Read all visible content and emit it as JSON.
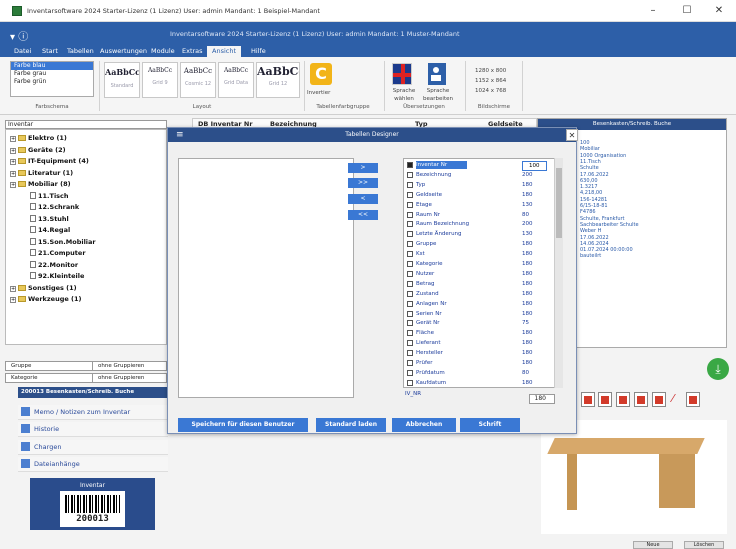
{
  "window": {
    "title": "Inventarsoftware 2024 Starter-Lizenz (1 Lizenz)   User: admin   Mandant: 1 Beispiel-Mandant",
    "doc_title": "Inventarsoftware 2024 Starter-Lizenz (1 Lizenz)   User: admin   Mandant: 1 Muster-Mandant",
    "minimize": "–",
    "maximize": "☐",
    "close": "✕"
  },
  "menu": [
    "Datei",
    "Start",
    "Tabellen",
    "Auswertungen",
    "Module",
    "Extras",
    "Ansicht",
    "Hilfe"
  ],
  "menu_active": "Ansicht",
  "ribbon": {
    "fonts": [
      "Farbe blau",
      "Farbe grau",
      "Farbe grün"
    ],
    "styles": [
      {
        "preview": "AaBbCc",
        "label": "Standard"
      },
      {
        "preview": "AaBbCc",
        "label": "Grid 9"
      },
      {
        "preview": "AaBbCc",
        "label": "Cosmic 12"
      },
      {
        "preview": "AaBbCc",
        "label": "Grid Data"
      },
      {
        "preview": "AaBbCc",
        "label": "Grid 12"
      }
    ],
    "invert_label": "Invertier",
    "lang_label": "Sprache wählen",
    "settings_label": "Sprache bearbeiten",
    "dimensions": [
      "1280 x 800",
      "1152 x 864",
      "1024 x 768"
    ],
    "group_labels": [
      "Farbschema",
      "Layout",
      "Tabellenfarbgruppe",
      "Übersetzungen",
      "Bildschirme"
    ]
  },
  "left": {
    "search": "Inventar",
    "tree": [
      {
        "label": "Elektro (1)",
        "level": 0,
        "type": "folder"
      },
      {
        "label": "Geräte (2)",
        "level": 0,
        "type": "folder"
      },
      {
        "label": "IT-Equipment (4)",
        "level": 0,
        "type": "folder"
      },
      {
        "label": "Literatur (1)",
        "level": 0,
        "type": "folder"
      },
      {
        "label": "Mobiliar (8)",
        "level": 0,
        "type": "folder"
      },
      {
        "label": "11.Tisch",
        "level": 1,
        "type": "doc"
      },
      {
        "label": "12.Schrank",
        "level": 1,
        "type": "doc"
      },
      {
        "label": "13.Stuhl",
        "level": 1,
        "type": "doc"
      },
      {
        "label": "14.Regal",
        "level": 1,
        "type": "doc"
      },
      {
        "label": "15.Son.Mobiliar",
        "level": 1,
        "type": "doc"
      },
      {
        "label": "21.Computer",
        "level": 1,
        "type": "doc"
      },
      {
        "label": "22.Monitor",
        "level": 1,
        "type": "doc"
      },
      {
        "label": "92.Kleinteile",
        "level": 1,
        "type": "doc"
      },
      {
        "label": "Sonstiges (1)",
        "level": 0,
        "type": "folder"
      },
      {
        "label": "Werkzeuge (1)",
        "level": 0,
        "type": "folder"
      }
    ],
    "group1_left": "Gruppe",
    "group1_right": "ohne Gruppieren",
    "group2_left": "Kategorie",
    "group2_right": "ohne Gruppieren",
    "detail_header": "200013 Besenkasten/Schreib. Buche",
    "nav": [
      {
        "label": "Memo / Notizen zum Inventar"
      },
      {
        "label": "Historie"
      },
      {
        "label": "Chargen"
      },
      {
        "label": "Dateianhänge"
      }
    ],
    "barcode_title": "Inventar",
    "barcode_number": "200013"
  },
  "grid": {
    "headers": [
      "DB Inventar Nr",
      "Bezeichnung",
      "Typ",
      "Geldseite"
    ]
  },
  "dialog": {
    "title": "Tabellen Designer",
    "move_buttons": [
      ">",
      ">>",
      "<",
      "<<"
    ],
    "fields": [
      {
        "name": "Inventar Nr",
        "width": "100",
        "checked": true,
        "selected": true
      },
      {
        "name": "Bezeichnung",
        "width": "200",
        "checked": false
      },
      {
        "name": "Typ",
        "width": "180",
        "checked": false
      },
      {
        "name": "Geldseite",
        "width": "180",
        "checked": false
      },
      {
        "name": "Etage",
        "width": "130",
        "checked": false
      },
      {
        "name": "Raum Nr",
        "width": "80",
        "checked": false
      },
      {
        "name": "Raum Bezeichnung",
        "width": "200",
        "checked": false
      },
      {
        "name": "Letzte Änderung",
        "width": "130",
        "checked": false
      },
      {
        "name": "Gruppe",
        "width": "180",
        "checked": false
      },
      {
        "name": "Kst",
        "width": "180",
        "checked": false
      },
      {
        "name": "Kategorie",
        "width": "180",
        "checked": false
      },
      {
        "name": "Nutzer",
        "width": "180",
        "checked": false
      },
      {
        "name": "Betrag",
        "width": "180",
        "checked": false
      },
      {
        "name": "Zustand",
        "width": "180",
        "checked": false
      },
      {
        "name": "Anlagen Nr",
        "width": "180",
        "checked": false
      },
      {
        "name": "Serien Nr",
        "width": "180",
        "checked": false
      },
      {
        "name": "Gerät Nr",
        "width": "75",
        "checked": false
      },
      {
        "name": "Fläche",
        "width": "180",
        "checked": false
      },
      {
        "name": "Lieferant",
        "width": "180",
        "checked": false
      },
      {
        "name": "Hersteller",
        "width": "180",
        "checked": false
      },
      {
        "name": "Prüfer",
        "width": "180",
        "checked": false
      },
      {
        "name": "Prüfdatum",
        "width": "80",
        "checked": false
      },
      {
        "name": "Kaufdatum",
        "width": "180",
        "checked": false
      }
    ],
    "sort_label": "IV_NR",
    "spin_value": "180",
    "buttons": [
      "Speichern für diesen Benutzer",
      "Standard laden",
      "Abbrechen",
      "Schrift"
    ]
  },
  "right": {
    "header": "Besenkasten/Schreib. Buche",
    "lines": [
      "100",
      "Mobiliar",
      "1000 Organisation",
      "11.Tisch",
      "Schulte",
      "17.06.2022",
      "630,00",
      "1.3217",
      "4,218,00",
      "156-14281",
      "6/15-18-81",
      "F4786",
      "Schulte, Frankfurt",
      "Sachbearbeiter Schulte",
      "Weber H",
      "17.06.2022",
      "14.06.2024",
      "01.07.2024 00:00:00",
      "bauteilrt"
    ]
  },
  "status": [
    "Neue",
    "Löschen"
  ]
}
